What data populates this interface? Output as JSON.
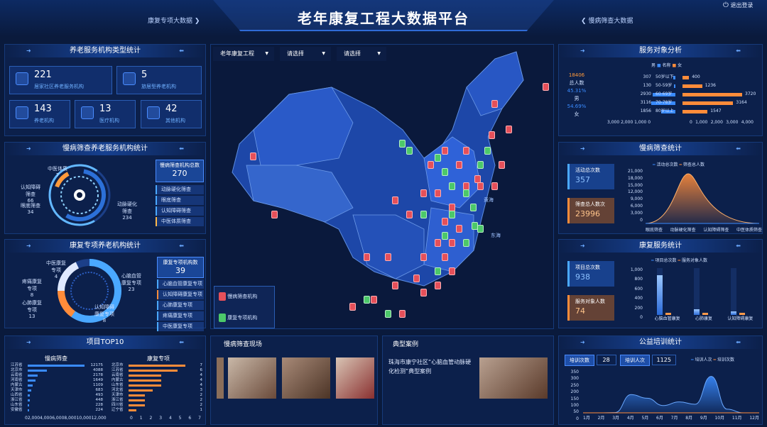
{
  "header": {
    "title": "老年康复工程大数据平台",
    "nav_left": "康复专项大数据",
    "nav_right": "慢病筛查大数据",
    "logout": "退出登录"
  },
  "inst": {
    "title": "养老服务机构类型统计",
    "cards": [
      {
        "value": "221",
        "label": "居家社区养老服务机构"
      },
      {
        "value": "5",
        "label": "旅居型养老机构"
      },
      {
        "value": "143",
        "label": "养老机构"
      },
      {
        "value": "13",
        "label": "医疗机构"
      },
      {
        "value": "42",
        "label": "其他机构"
      }
    ]
  },
  "screen_inst": {
    "title": "慢病筛查养老服务机构统计",
    "labels": {
      "a": "中医体质",
      "a_n": "7",
      "b": "认知障碍",
      "b2": "筛查",
      "b_n": "66",
      "c": "眼底筛查",
      "c_n": "34",
      "d": "动脉硬化",
      "d2": "筛查",
      "d_n": "234"
    },
    "total_label": "慢病筛查机构总数",
    "total": "270",
    "items": [
      "动脉硬化筛查",
      "眼底筛查",
      "认知障碍筛查",
      "中医体质筛查"
    ]
  },
  "rehab_inst": {
    "title": "康复专项养老机构统计",
    "labels": {
      "a": "中医康复",
      "a2": "专项",
      "a_n": "4",
      "b": "疼痛康复",
      "b2": "专项",
      "b_n": "8",
      "c": "心肺康复",
      "c2": "专项",
      "c_n": "13",
      "d": "心脑血管",
      "d2": "康复专项",
      "d_n": "23",
      "e": "认知障碍",
      "e2": "康复专项",
      "e_n": "8"
    },
    "total_label": "康复专项机构数",
    "total": "39",
    "items": [
      "心脑血管康复专项",
      "认知障碍康复专项",
      "心肺康复专项",
      "疼痛康复专项",
      "中医康复专项"
    ]
  },
  "filters": [
    "老年康复工程",
    "请选择",
    "请选择"
  ],
  "map": {
    "labels": {
      "huanghai": "黄海",
      "donghai": "东海"
    },
    "legend": [
      "慢病筛查机构",
      "康复专项机构"
    ]
  },
  "top10": {
    "title": "项目TOP10",
    "left_title": "慢病筛查",
    "right_title": "康复专项",
    "left": [
      {
        "n": "江苏省",
        "v": "12175",
        "f": 1.0
      },
      {
        "n": "北京市",
        "v": "4088",
        "f": 0.34
      },
      {
        "n": "云南省",
        "v": "2178",
        "f": 0.18
      },
      {
        "n": "河南省",
        "v": "1649",
        "f": 0.14
      },
      {
        "n": "内蒙古",
        "v": "1109",
        "f": 0.09
      },
      {
        "n": "天津市",
        "v": "683",
        "f": 0.06
      },
      {
        "n": "山西省",
        "v": "493",
        "f": 0.04
      },
      {
        "n": "浙江省",
        "v": "448",
        "f": 0.04
      },
      {
        "n": "山东省",
        "v": "228",
        "f": 0.02
      },
      {
        "n": "安徽省",
        "v": "224",
        "f": 0.02
      }
    ],
    "left_ticks": [
      "0",
      "2,000",
      "4,000",
      "6,000",
      "8,000",
      "10,000",
      "12,000"
    ],
    "right": [
      {
        "n": "北京市",
        "v": "7",
        "f": 1.0
      },
      {
        "n": "江苏省",
        "v": "6",
        "f": 0.86
      },
      {
        "n": "云南省",
        "v": "4",
        "f": 0.57
      },
      {
        "n": "内蒙古",
        "v": "4",
        "f": 0.57
      },
      {
        "n": "山东省",
        "v": "4",
        "f": 0.57
      },
      {
        "n": "河北省",
        "v": "3",
        "f": 0.43
      },
      {
        "n": "天津市",
        "v": "2",
        "f": 0.29
      },
      {
        "n": "浙江省",
        "v": "2",
        "f": 0.29
      },
      {
        "n": "四川省",
        "v": "2",
        "f": 0.29
      },
      {
        "n": "辽宁省",
        "v": "1",
        "f": 0.14
      }
    ],
    "right_ticks": [
      "0",
      "1",
      "2",
      "3",
      "4",
      "5",
      "6",
      "7"
    ]
  },
  "scene": {
    "title": "慢病筛查现场"
  },
  "case": {
    "title": "典型案例",
    "text": "珠海市康宁社区“心脑血管动脉硬化检测”典型案例"
  },
  "service_obj": {
    "title": "服务对象分析",
    "legend": [
      "男",
      "名称",
      "女"
    ],
    "total_label": "总人数",
    "total": "18406",
    "male_pct": "45.31%",
    "male": "男",
    "female_pct": "54.69%",
    "female": "女",
    "rows": [
      {
        "age": "50岁以下",
        "m": "307",
        "mf": 0.08,
        "f": "400",
        "ff": 0.11
      },
      {
        "age": "50-59岁",
        "m": "130",
        "mf": 0.04,
        "f": "1236",
        "ff": 0.33
      },
      {
        "age": "60-69岁",
        "m": "2930",
        "mf": 0.79,
        "f": "3720",
        "ff": 1.0
      },
      {
        "age": "70-78岁",
        "m": "3116",
        "mf": 0.84,
        "f": "3164",
        "ff": 0.85
      },
      {
        "age": "80岁以上",
        "m": "1856",
        "mf": 0.5,
        "f": "1547",
        "ff": 0.42
      }
    ],
    "ticks_left": "3,000 2,000 1,000 0",
    "ticks_right": [
      "0",
      "1,000",
      "2,000",
      "3,000",
      "4,000"
    ]
  },
  "screening": {
    "title": "慢病筛查统计",
    "legend": [
      "活动总次数",
      "筛查总人数"
    ],
    "a_label": "活动总次数",
    "a_val": "357",
    "b_label": "筛查总人数次",
    "b_val": "23996",
    "y": [
      "21,000",
      "18,000",
      "15,000",
      "12,000",
      "9,000",
      "6,000",
      "3,000",
      "0"
    ],
    "x": [
      "眼底筛查",
      "动脉硬化筛查",
      "认知障碍筛查",
      "中医体质筛查"
    ]
  },
  "rehab_service": {
    "title": "康复服务统计",
    "legend": [
      "项目总次数",
      "服务对象人数"
    ],
    "a_label": "项目总次数",
    "a_val": "938",
    "b_label": "服务对象人数",
    "b_val": "74",
    "y": [
      "1,000",
      "800",
      "600",
      "400",
      "200",
      "0"
    ],
    "x": [
      "心脑血管康复",
      "心肺康复",
      "认知障碍康复"
    ],
    "bars": [
      {
        "a": 0.85,
        "b": 0.05
      },
      {
        "a": 0.12,
        "b": 0.05
      },
      {
        "a": 0.08,
        "b": 0.04
      }
    ]
  },
  "training": {
    "title": "公益培训统计",
    "a_label": "培训次数",
    "a_val": "28",
    "b_label": "培训人次",
    "b_val": "1125",
    "legend": [
      "培训人次",
      "培训次数"
    ],
    "y": [
      "350",
      "300",
      "250",
      "200",
      "150",
      "100",
      "50",
      "0"
    ],
    "x": [
      "1月",
      "2月",
      "3月",
      "4月",
      "5月",
      "6月",
      "7月",
      "8月",
      "9月",
      "10月",
      "11月",
      "12月"
    ],
    "values": [
      0,
      0,
      2,
      150,
      120,
      60,
      90,
      70,
      300,
      30,
      0,
      0
    ]
  },
  "colors": {
    "male": "#3a8bff",
    "female": "#ff8c3a",
    "green": "#4cc86a",
    "red": "#e5505a"
  }
}
